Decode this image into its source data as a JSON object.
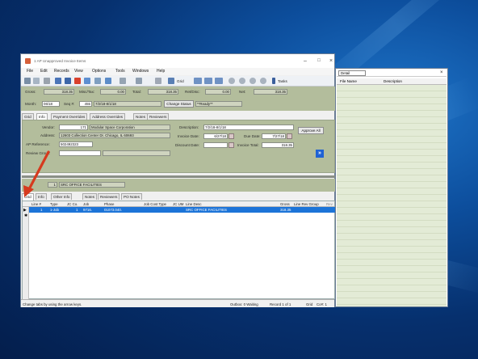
{
  "window": {
    "title": "1 AP Unapproved Invoice Items"
  },
  "menu": [
    "File",
    "Edit",
    "Records",
    "View",
    "Options",
    "Tools",
    "Windows",
    "Help"
  ],
  "toolbar": {
    "grid_label": "Grid",
    "tasks_label": "Tasks"
  },
  "summary": {
    "gross_label": "Gross:",
    "gross": "318.35",
    "misc_label": "Misc/Tax:",
    "misc": "0.00",
    "total_label": "Total:",
    "total": "318.35",
    "retdisc_label": "Ret/Disc:",
    "retdisc": "0.00",
    "net_label": "Net:",
    "net": "318.35",
    "month_label": "Month:",
    "month": "06/18",
    "seq_label": "Seq #:",
    "seq": "455",
    "seq_desc": "7/2/18-8/1/18",
    "change_status_label": "Change Status",
    "status": "**Ready**"
  },
  "header_tabs": [
    "Grid",
    "Info",
    "Payment Overrides",
    "Address Overrides",
    "Notes",
    "Reviewers"
  ],
  "info": {
    "vendor_label": "Vendor:",
    "vendor_num": "171",
    "vendor_name": "Modular Space Corporation",
    "address_label": "Address:",
    "address": "12603 Collection Center Dr.  Chicago, IL 60693",
    "apref_label": "AP Reference:",
    "apref": "502492323",
    "review_group_label": "Review Group:",
    "description_label": "Description:",
    "description": "7/2/18-8/1/18",
    "invoice_date_label": "Invoice Date:",
    "invoice_date": "6/27/18",
    "due_date_label": "Due Date:",
    "due_date": "7/27/18",
    "discount_date_label": "Discount Date:",
    "invoice_total_label": "Invoice Total:",
    "invoice_total": "318.35",
    "approve_all_label": "Approve All"
  },
  "line_header": {
    "line_num": "1",
    "line_desc": "SRC OFFICE FACILITIES"
  },
  "line_tabs": [
    "Grid",
    "Info",
    "Other Info",
    "Notes",
    "Reviewers",
    "PO Notes"
  ],
  "grid": {
    "columns": [
      "Line #",
      "Type",
      "JC Co.",
      "Job",
      "Phase",
      "Job Cost Type",
      "JC UM",
      "Line Desc",
      "Gross",
      "Line Rev Group",
      "Rev"
    ],
    "rows": [
      {
        "line": "1",
        "type": "1-Job",
        "jcco": "1",
        "job": "9716.",
        "phase": "01073.040.",
        "jct": "",
        "um": "",
        "desc": "SRC OFFICE FACILITIES",
        "gross": "318.35",
        "revgroup": ""
      }
    ]
  },
  "status_bar": {
    "hint": "Change tabs by using the arrow keys.",
    "outbox": "Outbox: 0 Waiting",
    "record": "Record 1 of 1",
    "mode": "Grid",
    "co": "Co#: 1"
  },
  "side_panel": {
    "dropdown": "Detail",
    "col_filename": "File Name",
    "col_description": "Description"
  },
  "colors": {
    "panel": "#b3bd9c",
    "selection": "#1c74d8",
    "annotation_arrow": "#d63a1e"
  }
}
